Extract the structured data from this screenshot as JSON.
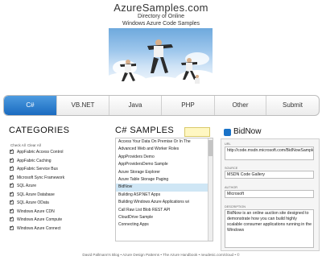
{
  "header": {
    "title": "AzureSamples.com",
    "subtitle_line1": "Directory of Online",
    "subtitle_line2": "Windows Azure Code Samples"
  },
  "tabs": [
    {
      "label": "C#",
      "active": true
    },
    {
      "label": "VB.NET",
      "active": false
    },
    {
      "label": "Java",
      "active": false
    },
    {
      "label": "PHP",
      "active": false
    },
    {
      "label": "Other",
      "active": false
    },
    {
      "label": "Submit",
      "active": false
    }
  ],
  "categories": {
    "title": "CATEGORIES",
    "check_all": "Check All",
    "clear_all": "Clear All",
    "items": [
      "AppFabric Access Control",
      "AppFabric Caching",
      "AppFabric Service Bus",
      "Microsoft Sync Framework",
      "SQL Azure",
      "SQL Azure Database",
      "SQL Azure OData",
      "Windows Azure CDN",
      "Windows Azure Compute",
      "Windows Azure Connect"
    ]
  },
  "samples": {
    "title": "C# SAMPLES",
    "items": [
      "Access Your Data On Premise Or In The",
      "Advanced Web and Worker Roles",
      "AppProviders Demo",
      "AppProvidersDemo Sample",
      "Azure Storage Explorer",
      "Azure Table Storage Paging",
      "BidNow",
      "Building ASP.NET Apps",
      "Building Windows Azure Applications wi",
      "Call Raw List Blob REST API",
      "CloudDrive Sample",
      "Connecting Apps"
    ],
    "selected_index": 6
  },
  "detail": {
    "title": "BidNow",
    "url_label": "URL",
    "url_value": "http://code.msdn.microsoft.com/BidNowSample",
    "source_label": "SOURCE",
    "source_value": "MSDN Code Gallery",
    "author_label": "AUTHOR",
    "author_value": "Microsoft",
    "description_label": "DESCRIPTION",
    "description_value": "BidNow is an online auction site designed to demonstrate how you can build highly scalable consumer applications running in the Windows"
  },
  "footer": {
    "text": "David Pallmann's Blog • Azure Design Patterns • The Azure Handbook • neudesic.com/cloud • ©"
  },
  "colors": {
    "accent": "#1a6bc0",
    "selected_row": "#cfe6f5",
    "search_box": "#fff7c2"
  }
}
